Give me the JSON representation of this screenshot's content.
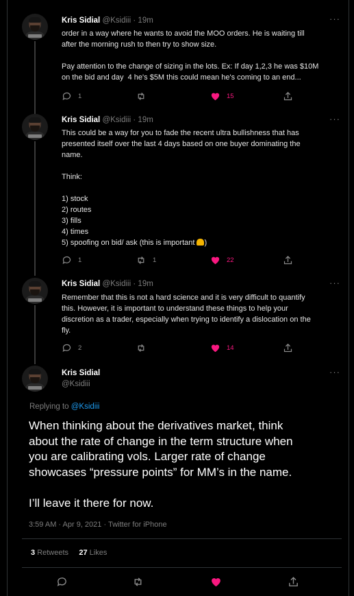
{
  "author": {
    "name": "Kris Sidial",
    "handle": "@Ksidiii",
    "sep": "·"
  },
  "tweets": [
    {
      "time": "19m",
      "text": "order in a way where he wants to avoid the MOO orders. He is waiting till\nafter the morning rush to then try to show size.\n\nPay attention to the change of sizing in the lots. Ex: If day 1,2,3 he was $10M\non the bid and day  4 he's $5M this could mean he's coming to an end...",
      "replies": "1",
      "retweets": "",
      "likes": "15"
    },
    {
      "time": "19m",
      "text": "This could be a way for you to fade the recent ultra bullishness that has\npresented itself over the last 4 days based on one buyer dominating the\nname.\n\nThink:\n\n1) stock\n2) routes\n3) fills\n4) times\n5) spoofing on bid/ ask (this is important ",
      "text_end": ")",
      "replies": "1",
      "retweets": "1",
      "likes": "22"
    },
    {
      "time": "19m",
      "text": "Remember that this is not a hard science and it is very difficult to quantify\nthis. However, it is important to understand these things to help your\ndiscretion as a trader, especially when trying to identify a dislocation on the\nfly.",
      "replies": "2",
      "retweets": "",
      "likes": "14"
    }
  ],
  "main": {
    "replying_label": "Replying to",
    "replying_handle": "@Ksidiii",
    "text": "When thinking about the derivatives market, think\nabout the rate of change in the term structure when\nyou are calibrating vols. Larger rate of change\nshowcases “pressure points” for MM’s in the name.\n\nI’ll leave it there for now.",
    "timestamp": "3:59 AM · Apr 9, 2021 · Twitter for iPhone",
    "retweets_count": "3",
    "retweets_label": "Retweets",
    "likes_count": "27",
    "likes_label": "Likes"
  },
  "icons": {
    "more": "more-horizontal-icon",
    "reply": "reply-bubble-icon",
    "retweet": "retweet-icon",
    "like": "heart-icon",
    "share": "share-upload-icon",
    "emoji": "bell-emoji-icon"
  },
  "colors": {
    "like": "#f91880",
    "link": "#1d9bf0",
    "muted": "#7d7d7d",
    "border": "#2f3336"
  }
}
